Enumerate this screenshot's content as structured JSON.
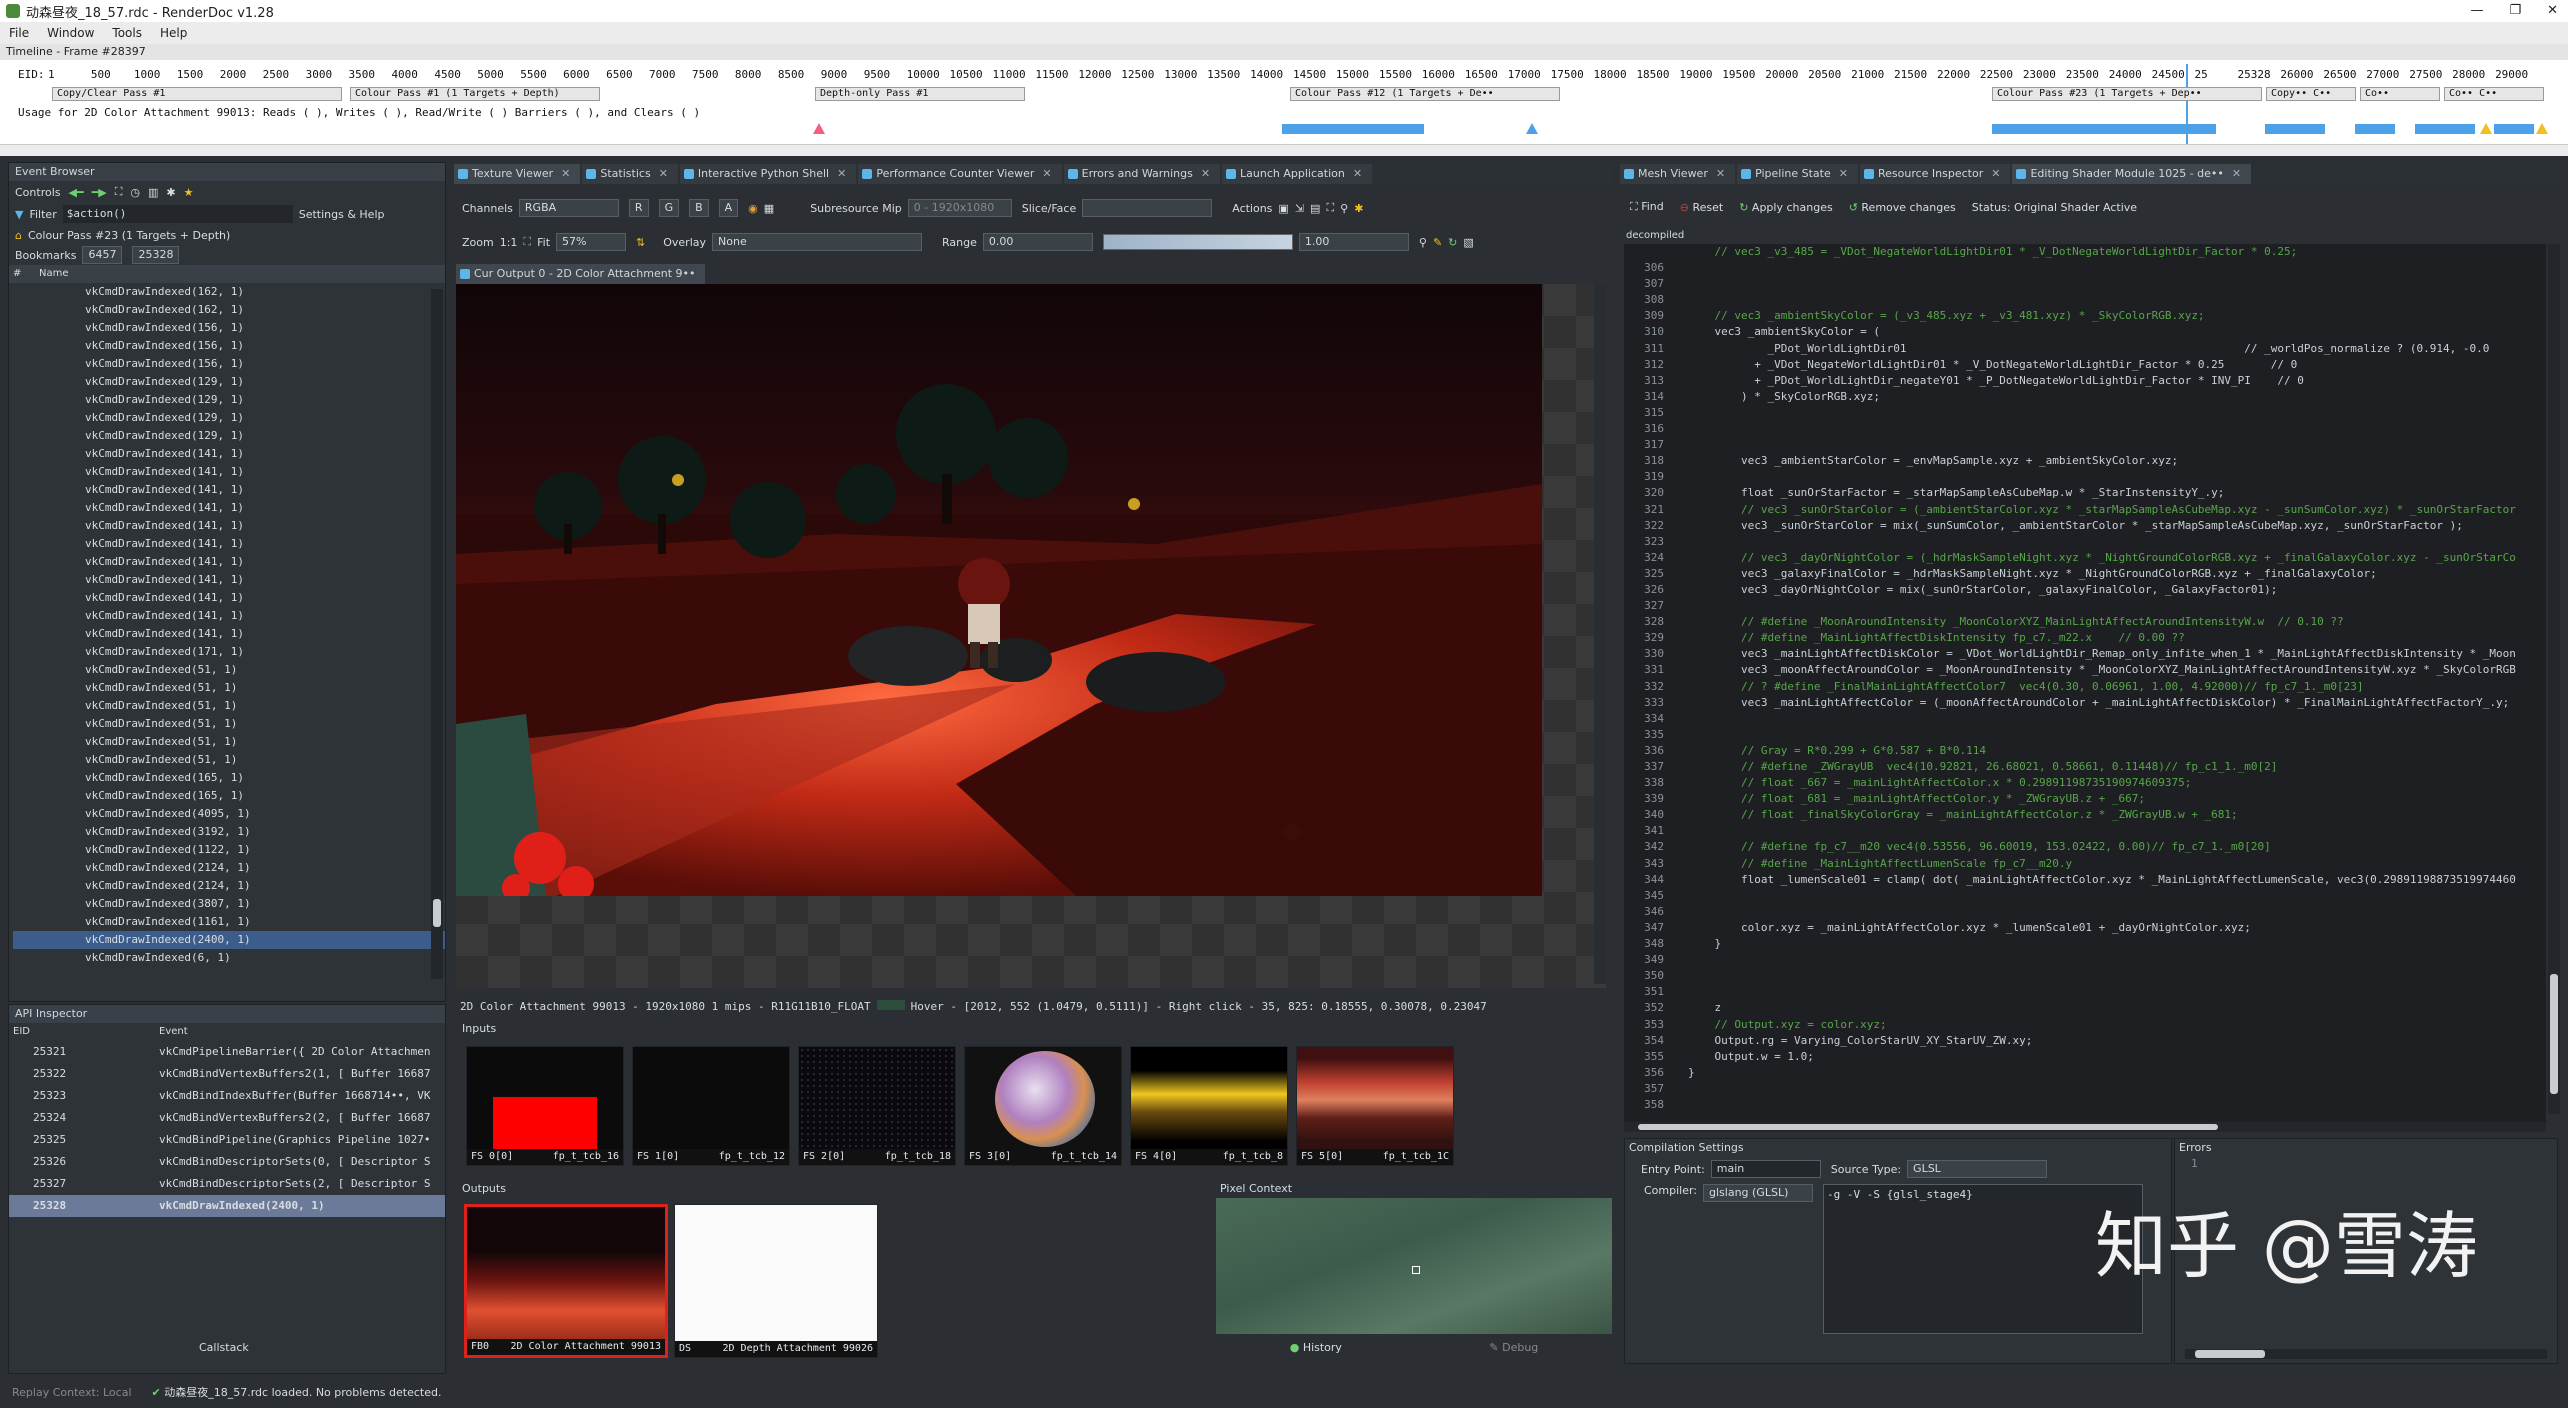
{
  "window": {
    "title": "动森昼夜_18_57.rdc - RenderDoc v1.28",
    "controls": [
      "—",
      "❐",
      "✕"
    ]
  },
  "menu": [
    "File",
    "Window",
    "Tools",
    "Help"
  ],
  "timeline": {
    "title": "Timeline - Frame #28397",
    "eid_label": "EID:",
    "ticks": [
      "1",
      "500",
      "1000",
      "1500",
      "2000",
      "2500",
      "3000",
      "3500",
      "4000",
      "4500",
      "5000",
      "5500",
      "6000",
      "6500",
      "7000",
      "7500",
      "8000",
      "8500",
      "9000",
      "9500",
      "10000",
      "10500",
      "11000",
      "11500",
      "12000",
      "12500",
      "13000",
      "13500",
      "14000",
      "14500",
      "15000",
      "15500",
      "16000",
      "16500",
      "17000",
      "17500",
      "18000",
      "18500",
      "19000",
      "19500",
      "20000",
      "20500",
      "21000",
      "21500",
      "22000",
      "22500",
      "23000",
      "23500",
      "24000",
      "24500",
      "25",
      "25328",
      "26000",
      "26500",
      "27000",
      "27500",
      "28000",
      "29000"
    ],
    "passes": [
      "Copy/Clear Pass #1",
      "Colour Pass #1 (1 Targets + Depth)",
      "Depth-only Pass #1",
      "Colour Pass #12 (1 Targets + De••",
      "Colour Pass #23 (1 Targets + Dep••",
      "Copy•• C••",
      "Co••",
      "Co•• C••"
    ],
    "usage": "Usage for 2D Color Attachment 99013: Reads ( ), Writes ( ), Read/Write ( ) Barriers ( ), and Clears ( )"
  },
  "event_browser": {
    "title": "Event Browser",
    "controls_label": "Controls",
    "filter_label": "Filter",
    "filter_value": "$action()",
    "settings": "Settings & Help",
    "pass": "Colour Pass #23 (1 Targets + Depth)",
    "bookmarks_label": "Bookmarks",
    "bookmarks": [
      "6457",
      "25328"
    ],
    "col_eid": "#",
    "col_name": "Name",
    "rows": [
      "vkCmdDrawIndexed(162, 1)",
      "vkCmdDrawIndexed(162, 1)",
      "vkCmdDrawIndexed(156, 1)",
      "vkCmdDrawIndexed(156, 1)",
      "vkCmdDrawIndexed(156, 1)",
      "vkCmdDrawIndexed(129, 1)",
      "vkCmdDrawIndexed(129, 1)",
      "vkCmdDrawIndexed(129, 1)",
      "vkCmdDrawIndexed(129, 1)",
      "vkCmdDrawIndexed(141, 1)",
      "vkCmdDrawIndexed(141, 1)",
      "vkCmdDrawIndexed(141, 1)",
      "vkCmdDrawIndexed(141, 1)",
      "vkCmdDrawIndexed(141, 1)",
      "vkCmdDrawIndexed(141, 1)",
      "vkCmdDrawIndexed(141, 1)",
      "vkCmdDrawIndexed(141, 1)",
      "vkCmdDrawIndexed(141, 1)",
      "vkCmdDrawIndexed(141, 1)",
      "vkCmdDrawIndexed(141, 1)",
      "vkCmdDrawIndexed(171, 1)",
      "vkCmdDrawIndexed(51, 1)",
      "vkCmdDrawIndexed(51, 1)",
      "vkCmdDrawIndexed(51, 1)",
      "vkCmdDrawIndexed(51, 1)",
      "vkCmdDrawIndexed(51, 1)",
      "vkCmdDrawIndexed(51, 1)",
      "vkCmdDrawIndexed(165, 1)",
      "vkCmdDrawIndexed(165, 1)",
      "vkCmdDrawIndexed(4095, 1)",
      "vkCmdDrawIndexed(3192, 1)",
      "vkCmdDrawIndexed(1122, 1)",
      "vkCmdDrawIndexed(2124, 1)",
      "vkCmdDrawIndexed(2124, 1)",
      "vkCmdDrawIndexed(3807, 1)",
      "vkCmdDrawIndexed(1161, 1)",
      "vkCmdDrawIndexed(2400, 1)",
      "vkCmdDrawIndexed(6, 1)"
    ],
    "selected_index": 36
  },
  "api_inspector": {
    "title": "API Inspector",
    "col_eid": "EID",
    "col_event": "Event",
    "rows": [
      {
        "eid": "25321",
        "event": "vkCmdPipelineBarrier({ 2D Color Attachmen"
      },
      {
        "eid": "25322",
        "event": "vkCmdBindVertexBuffers2(1, [ Buffer 16687"
      },
      {
        "eid": "25323",
        "event": "vkCmdBindIndexBuffer(Buffer 1668714••, VK"
      },
      {
        "eid": "25324",
        "event": "vkCmdBindVertexBuffers2(2, [ Buffer 16687"
      },
      {
        "eid": "25325",
        "event": "vkCmdBindPipeline(Graphics Pipeline 1027•"
      },
      {
        "eid": "25326",
        "event": "vkCmdBindDescriptorSets(0, [ Descriptor S"
      },
      {
        "eid": "25327",
        "event": "vkCmdBindDescriptorSets(2, [ Descriptor S"
      },
      {
        "eid": "25328",
        "event": "vkCmdDrawIndexed(2400, 1)"
      }
    ],
    "callstack": "Callstack"
  },
  "statusbar": {
    "left": "Replay Context: Local",
    "msg": "动森昼夜_18_57.rdc loaded. No problems detected."
  },
  "center_tabs": [
    "Texture Viewer",
    "Statistics",
    "Interactive Python Shell",
    "Performance Counter Viewer",
    "Errors and Warnings",
    "Launch Application"
  ],
  "texture_viewer": {
    "channels_label": "Channels",
    "channels_value": "RGBA",
    "ch_buttons": [
      "R",
      "G",
      "B",
      "A"
    ],
    "subresource_label": "Subresource Mip",
    "subresource_value": "0 - 1920x1080",
    "slice_label": "Slice/Face",
    "actions_label": "Actions",
    "zoom_label": "Zoom",
    "zoom_value": "1:1",
    "fit_label": "Fit",
    "zoom_pct": "57%",
    "overlay_label": "Overlay",
    "overlay_value": "None",
    "range_label": "Range",
    "range_min": "0.00",
    "range_max": "1.00",
    "output_tab": "Cur Output 0 - 2D Color Attachment 9••",
    "status": "2D Color Attachment 99013 - 1920x1080 1 mips - R11G11B10_FLOAT",
    "hover": "Hover - [2012,  552 (1.0479, 0.5111)] - Right click -   35,  825: 0.18555, 0.30078, 0.23047",
    "inputs_label": "Inputs",
    "inputs": [
      {
        "slot": "FS 0[0]",
        "name": "fp_t_tcb_16"
      },
      {
        "slot": "FS 1[0]",
        "name": "fp_t_tcb_12"
      },
      {
        "slot": "FS 2[0]",
        "name": "fp_t_tcb_18"
      },
      {
        "slot": "FS 3[0]",
        "name": "fp_t_tcb_14"
      },
      {
        "slot": "FS 4[0]",
        "name": "fp_t_tcb_8"
      },
      {
        "slot": "FS 5[0]",
        "name": "fp_t_tcb_1C"
      }
    ],
    "outputs_label": "Outputs",
    "outputs": [
      {
        "slot": "FB0",
        "name": "2D Color Attachment 99013"
      },
      {
        "slot": "DS",
        "name": "2D Depth Attachment 99026"
      }
    ],
    "pixel_context": "Pixel Context",
    "history": "History",
    "debug": "Debug"
  },
  "right_tabs": [
    "Mesh Viewer",
    "Pipeline State",
    "Resource Inspector",
    "Editing Shader Module 1025 - de••"
  ],
  "shader_editor": {
    "find": "Find",
    "reset": "Reset",
    "apply": "Apply changes",
    "remove": "Remove changes",
    "status": "Status: Original Shader Active",
    "subtab": "decompiled",
    "first_line": "    // vec3 _v3_485 = _VDot_NegateWorldLightDir01 * _V_DotNegateWorldLightDir_Factor * 0.25;",
    "lines": [
      {
        "n": "306",
        "t": ""
      },
      {
        "n": "307",
        "t": ""
      },
      {
        "n": "308",
        "t": ""
      },
      {
        "n": "309",
        "t": "    // vec3 _ambientSkyColor = (_v3_485.xyz + _v3_481.xyz) * _SkyColorRGB.xyz;"
      },
      {
        "n": "310",
        "t": "    vec3 _ambientSkyColor = ("
      },
      {
        "n": "311",
        "t": "            _PDot_WorldLightDir01                                                   // _worldPos_normalize ? (0.914, -0.0"
      },
      {
        "n": "312",
        "t": "          + _VDot_NegateWorldLightDir01 * _V_DotNegateWorldLightDir_Factor * 0.25       // 0"
      },
      {
        "n": "313",
        "t": "          + _PDot_WorldLightDir_negateY01 * _P_DotNegateWorldLightDir_Factor * INV_PI    // 0"
      },
      {
        "n": "314",
        "t": "        ) * _SkyColorRGB.xyz;"
      },
      {
        "n": "315",
        "t": ""
      },
      {
        "n": "316",
        "t": ""
      },
      {
        "n": "317",
        "t": ""
      },
      {
        "n": "318",
        "t": "        vec3 _ambientStarColor = _envMapSample.xyz + _ambientSkyColor.xyz;"
      },
      {
        "n": "319",
        "t": ""
      },
      {
        "n": "320",
        "t": "        float _sunOrStarFactor = _starMapSampleAsCubeMap.w * _StarInstensityY_.y;"
      },
      {
        "n": "321",
        "t": "        // vec3 _sunOrStarColor = (_ambientStarColor.xyz * _starMapSampleAsCubeMap.xyz - _sunSumColor.xyz) * _sunOrStarFactor"
      },
      {
        "n": "322",
        "t": "        vec3 _sunOrStarColor = mix(_sunSumColor, _ambientStarColor * _starMapSampleAsCubeMap.xyz, _sunOrStarFactor );"
      },
      {
        "n": "323",
        "t": ""
      },
      {
        "n": "324",
        "t": "        // vec3 _dayOrNightColor = (_hdrMaskSampleNight.xyz * _NightGroundColorRGB.xyz + _finalGalaxyColor.xyz - _sunOrStarCo"
      },
      {
        "n": "325",
        "t": "        vec3 _galaxyFinalColor = _hdrMaskSampleNight.xyz * _NightGroundColorRGB.xyz + _finalGalaxyColor;"
      },
      {
        "n": "326",
        "t": "        vec3 _dayOrNightColor = mix(_sunOrStarColor, _galaxyFinalColor, _GalaxyFactor01);"
      },
      {
        "n": "327",
        "t": ""
      },
      {
        "n": "328",
        "t": "        // #define _MoonAroundIntensity _MoonColorXYZ_MainLightAffectAroundIntensityW.w  // 0.10 ??"
      },
      {
        "n": "329",
        "t": "        // #define _MainLightAffectDiskIntensity fp_c7._m22.x    // 0.00 ??"
      },
      {
        "n": "330",
        "t": "        vec3 _mainLightAffectDiskColor = _VDot_WorldLightDir_Remap_only_infite_when_1 * _MainLightAffectDiskIntensity * _Moon"
      },
      {
        "n": "331",
        "t": "        vec3 _moonAffectAroundColor = _MoonAroundIntensity * _MoonColorXYZ_MainLightAffectAroundIntensityW.xyz * _SkyColorRGB"
      },
      {
        "n": "332",
        "t": "        // ? #define _FinalMainLightAffectColor7  vec4(0.30, 0.06961, 1.00, 4.92000)// fp_c7_1._m0[23]"
      },
      {
        "n": "333",
        "t": "        vec3 _mainLightAffectColor = (_moonAffectAroundColor + _mainLightAffectDiskColor) * _FinalMainLightAffectFactorY_.y;"
      },
      {
        "n": "334",
        "t": ""
      },
      {
        "n": "335",
        "t": ""
      },
      {
        "n": "336",
        "t": "        // Gray = R*0.299 + G*0.587 + B*0.114"
      },
      {
        "n": "337",
        "t": "        // #define _ZWGrayUB  vec4(10.92821, 26.68021, 0.58661, 0.11448)// fp_c1_1._m0[2]"
      },
      {
        "n": "338",
        "t": "        // float _667 = _mainLightAffectColor.x * 0.29891198735190974609375;"
      },
      {
        "n": "339",
        "t": "        // float _681 = _mainLightAffectColor.y * _ZWGrayUB.z + _667;"
      },
      {
        "n": "340",
        "t": "        // float _finalSkyColorGray = _mainLightAffectColor.z * _ZWGrayUB.w + _681;"
      },
      {
        "n": "341",
        "t": ""
      },
      {
        "n": "342",
        "t": "        // #define fp_c7__m20 vec4(0.53556, 96.60019, 153.02422, 0.00)// fp_c7_1._m0[20]"
      },
      {
        "n": "343",
        "t": "        // #define _MainLightAffectLumenScale fp_c7__m20.y"
      },
      {
        "n": "344",
        "t": "        float _lumenScale01 = clamp( dot( _mainLightAffectColor.xyz * _MainLightAffectLumenScale, vec3(0.29891198873519974460"
      },
      {
        "n": "345",
        "t": ""
      },
      {
        "n": "346",
        "t": ""
      },
      {
        "n": "347",
        "t": "        color.xyz = _mainLightAffectColor.xyz * _lumenScale01 + _dayOrNightColor.xyz;"
      },
      {
        "n": "348",
        "t": "    }"
      },
      {
        "n": "349",
        "t": ""
      },
      {
        "n": "350",
        "t": ""
      },
      {
        "n": "351",
        "t": ""
      },
      {
        "n": "352",
        "t": "    z"
      },
      {
        "n": "353",
        "t": "    // Output.xyz = color.xyz;"
      },
      {
        "n": "354",
        "t": "    Output.rg = Varying_ColorStarUV_XY_StarUV_ZW.xy;"
      },
      {
        "n": "355",
        "t": "    Output.w = 1.0;"
      },
      {
        "n": "356",
        "t": "}"
      },
      {
        "n": "357",
        "t": ""
      },
      {
        "n": "358",
        "t": ""
      }
    ],
    "compilation": {
      "title": "Compilation Settings",
      "entry_label": "Entry Point:",
      "entry_value": "main",
      "source_label": "Source Type:",
      "source_value": "GLSL",
      "compiler_label": "Compiler:",
      "compiler_value": "glslang (GLSL)",
      "args": "-g -V -S {glsl_stage4}",
      "errors_label": "Errors",
      "errors_line": "1"
    }
  },
  "watermark": "知乎 @雪涛",
  "colors": {
    "accent": "#4da1e8",
    "panel": "#2e3338",
    "selected": "#3c5d8c",
    "code_green": "#57a64a",
    "code_blue": "#569cd6",
    "red_frame": "#e0201a"
  }
}
